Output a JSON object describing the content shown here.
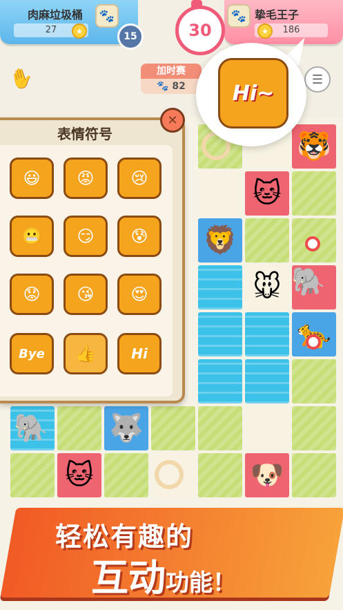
{
  "player_left": {
    "name": "肉麻垃圾桶",
    "score": "27",
    "level": "15",
    "badge_icon": "paw-badge-icon"
  },
  "player_right": {
    "name": "挚毛王子",
    "score": "186",
    "badge_icon": "paw-badge-icon"
  },
  "timer": {
    "value": "30"
  },
  "overtime": {
    "label": "加时赛",
    "value": "82",
    "icon": "paw-icon"
  },
  "speech": {
    "text": "Hi~"
  },
  "emoji_panel": {
    "title": "表情符号",
    "items": [
      {
        "name": "grin-emoji",
        "glyph": "😃"
      },
      {
        "name": "angry-emoji",
        "glyph": "😡"
      },
      {
        "name": "cry-emoji",
        "glyph": "😢"
      },
      {
        "name": "teeth-emoji",
        "glyph": "😬"
      },
      {
        "name": "smirk-emoji",
        "glyph": "😏"
      },
      {
        "name": "sweat-emoji",
        "glyph": "😰"
      },
      {
        "name": "worried-emoji",
        "glyph": "😟"
      },
      {
        "name": "kiss-emoji",
        "glyph": "😘"
      },
      {
        "name": "love-emoji",
        "glyph": "😍"
      },
      {
        "name": "bye-emoji",
        "glyph": "Bye"
      },
      {
        "name": "thumbs-up-emoji",
        "glyph": "👍"
      },
      {
        "name": "hi-emoji",
        "glyph": "Hi"
      }
    ]
  },
  "banner": {
    "line1": "轻松有趣的",
    "line2_big": "互动",
    "line2_small": "功能！"
  },
  "colors": {
    "accent_pink": "#ef5b78",
    "accent_blue": "#5cb6ea",
    "banner_orange": "#f15a25",
    "grass": "#c6de77",
    "water": "#3cc2e8"
  }
}
